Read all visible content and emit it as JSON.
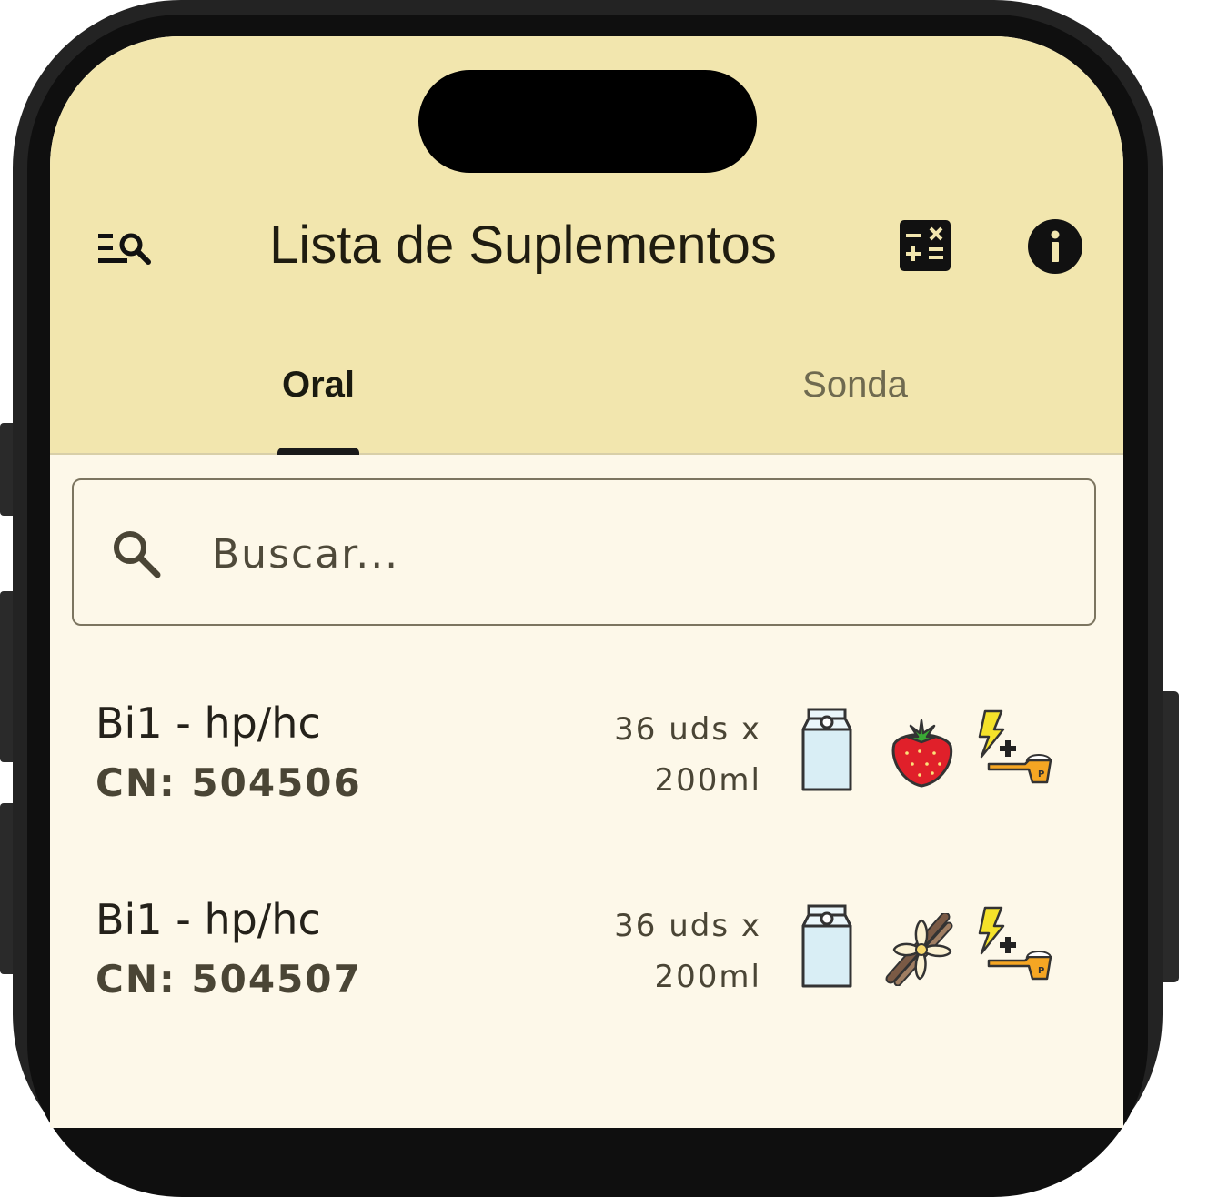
{
  "header": {
    "title": "Lista de Suplementos",
    "menu_icon": "filter-search-icon",
    "calculator_icon": "calculator-icon",
    "info_icon": "info-icon"
  },
  "tabs": [
    {
      "label": "Oral",
      "selected": true
    },
    {
      "label": "Sonda",
      "selected": false
    }
  ],
  "search": {
    "placeholder": "Buscar...",
    "value": "",
    "icon": "search-icon"
  },
  "items": [
    {
      "name": "Bi1 - hp/hc",
      "cn": "CN: 504506",
      "qty_line1": "36 uds x",
      "qty_line2": "200ml",
      "format_icon": "carton-icon",
      "flavor_icon": "strawberry-icon",
      "type_icon": "energy-protein-icon"
    },
    {
      "name": "Bi1 - hp/hc",
      "cn": "CN: 504507",
      "qty_line1": "36 uds x",
      "qty_line2": "200ml",
      "format_icon": "carton-icon",
      "flavor_icon": "vanilla-icon",
      "type_icon": "energy-protein-icon"
    }
  ],
  "colors": {
    "appbar": "#f2e6ae",
    "background": "#fdf8e9",
    "text": "#24211a",
    "accent": "#1a1a1a"
  }
}
